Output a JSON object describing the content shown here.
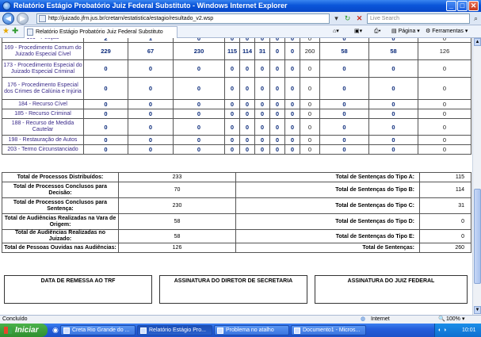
{
  "window": {
    "title": "Relatório Estágio Probatório Juiz Federal Substituto - Windows Internet Explorer"
  },
  "address": {
    "url": "http://juizado.jfrn.jus.br/cretarn/estatistica/estagio/resultado_v2.wsp",
    "search_placeholder": "Live Search"
  },
  "tab": {
    "label": "Relatório Estágio Probatório Juiz Federal Substituto"
  },
  "commands": {
    "page": "Página",
    "tools": "Ferramentas"
  },
  "proc_rows": [
    {
      "name": "169 - Procedimento Comum do Juizado Especial Cível",
      "v": [
        "229",
        "67",
        "230",
        "115",
        "114",
        "31",
        "0",
        "0",
        "260",
        "58",
        "58",
        "126"
      ]
    },
    {
      "name": "173 - Procedimento Especial do Juizado Especial Criminal",
      "v": [
        "0",
        "0",
        "0",
        "0",
        "0",
        "0",
        "0",
        "0",
        "0",
        "0",
        "0",
        "0"
      ]
    },
    {
      "name": "176 - Procedimento Especial dos Crimes de Calúnia e Injúria",
      "v": [
        "0",
        "0",
        "0",
        "0",
        "0",
        "0",
        "0",
        "0",
        "0",
        "0",
        "0",
        "0"
      ]
    },
    {
      "name": "184 - Recurso Cível",
      "v": [
        "0",
        "0",
        "0",
        "0",
        "0",
        "0",
        "0",
        "0",
        "0",
        "0",
        "0",
        "0"
      ]
    },
    {
      "name": "185 - Recurso Criminal",
      "v": [
        "0",
        "0",
        "0",
        "0",
        "0",
        "0",
        "0",
        "0",
        "0",
        "0",
        "0",
        "0"
      ]
    },
    {
      "name": "188 - Recurso de Medida Cautelar",
      "v": [
        "0",
        "0",
        "0",
        "0",
        "0",
        "0",
        "0",
        "0",
        "0",
        "0",
        "0",
        "0"
      ]
    },
    {
      "name": "198 - Restauração de Autos",
      "v": [
        "0",
        "0",
        "0",
        "0",
        "0",
        "0",
        "0",
        "0",
        "0",
        "0",
        "0",
        "0"
      ]
    },
    {
      "name": "203 - Termo Circunstanciado",
      "v": [
        "0",
        "0",
        "0",
        "0",
        "0",
        "0",
        "0",
        "0",
        "0",
        "0",
        "0",
        "0"
      ]
    }
  ],
  "totals": [
    {
      "label": "Total de Processos Distribuídos:",
      "value": "233",
      "label2": "Total de Sentenças do Tipo A:",
      "value2": "115"
    },
    {
      "label": "Total de Processos Conclusos para Decisão:",
      "value": "70",
      "label2": "Total de Sentenças do Tipo B:",
      "value2": "114"
    },
    {
      "label": "Total de Processos Conclusos para Sentença:",
      "value": "230",
      "label2": "Total de Sentenças do Tipo C:",
      "value2": "31"
    },
    {
      "label": "Total de Audiências Realizadas na Vara de Origem:",
      "value": "58",
      "label2": "Total de Sentenças do Tipo D:",
      "value2": "0"
    },
    {
      "label": "Total de Audiências Realizadas no Juizado:",
      "value": "58",
      "label2": "Total de Sentenças do Tipo E:",
      "value2": "0"
    },
    {
      "label": "Total de Pessoas Ouvidas nas Audiências:",
      "value": "126",
      "label2": "Total de Sentenças:",
      "value2": "260"
    }
  ],
  "signatures": {
    "remessa": "DATA DE REMESSA AO TRF",
    "diretor": "ASSINATURA DO DIRETOR DE SECRETARIA",
    "juiz": "ASSINATURA DO JUIZ FEDERAL"
  },
  "status": {
    "left": "Concluído",
    "zone": "Internet",
    "zoom": "100%"
  },
  "taskbar": {
    "start": "Iniciar",
    "tasks": [
      "Creta Rio Grande do ...",
      "Relatório Estágio Pro...",
      "Problema no atalho",
      "Documento1 - Micros..."
    ],
    "clock": "10:01"
  }
}
